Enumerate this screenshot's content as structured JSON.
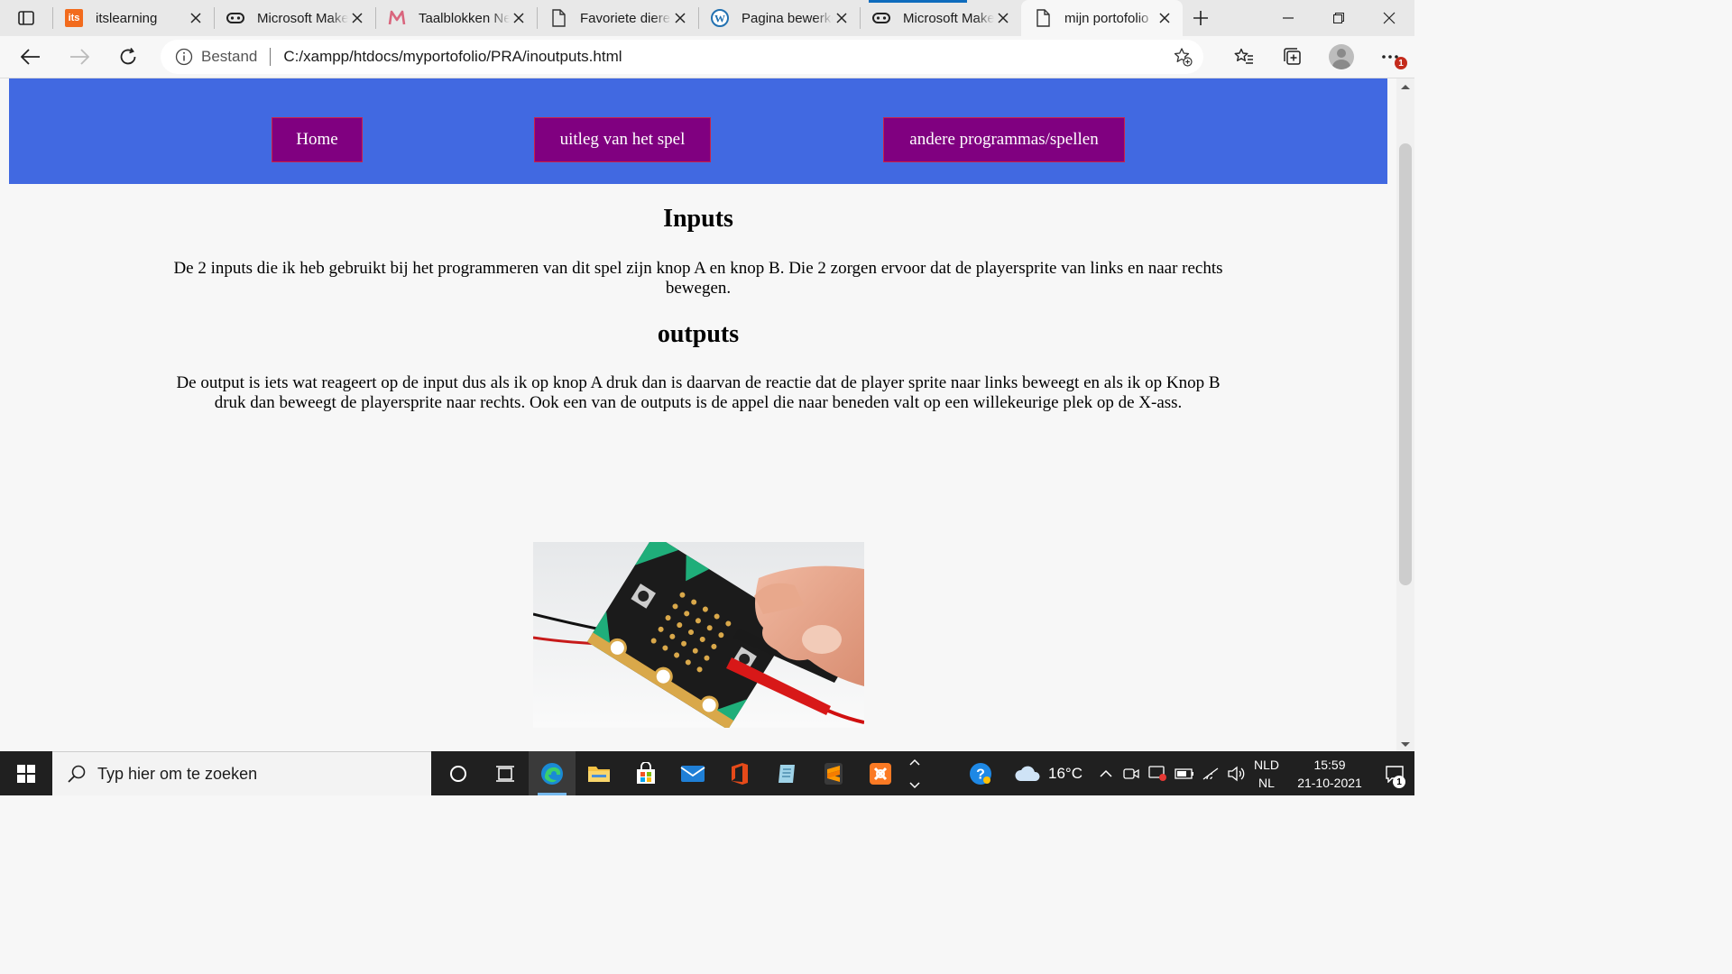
{
  "browser": {
    "tabs": [
      {
        "title": "itslearning",
        "icon": "itslearning-icon",
        "favicon_text": "its"
      },
      {
        "title": "Microsoft MakeCode",
        "icon": "makecode-icon"
      },
      {
        "title": "Taalblokken Nederlands",
        "icon": "taalblokken-icon"
      },
      {
        "title": "Favoriete dieren",
        "icon": "page-icon"
      },
      {
        "title": "Pagina bewerken",
        "icon": "wordpress-icon"
      },
      {
        "title": "Microsoft MakeCode",
        "icon": "makecode-icon"
      },
      {
        "title": "mijn portofolio",
        "icon": "page-icon",
        "active": true
      }
    ],
    "address": {
      "scheme_label": "Bestand",
      "url": "C:/xampp/htdocs/myportofolio/PRA/inoutputs.html"
    },
    "notification_badge": "1"
  },
  "page": {
    "nav": {
      "home": "Home",
      "uitleg": "uitleg van het spel",
      "andere": "andere programmas/spellen"
    },
    "inputs_heading": "Inputs",
    "inputs_text": "De 2 inputs die ik heb gebruikt bij het programmeren van dit spel zijn knop A en knop B. Die 2 zorgen ervoor dat de playersprite van links en naar rechts bewegen.",
    "outputs_heading": "outputs",
    "outputs_text": "De output is iets wat reageert op de input dus als ik op knop A druk dan is daarvan de reactie dat de player sprite naar links beweegt en als ik op Knop B druk dan beweegt de playersprite naar rechts. Ook een van de outputs is de appel die naar beneden valt op een willekeurige plek op de X-ass.",
    "image_alt": "micro:bit board"
  },
  "taskbar": {
    "search_placeholder": "Typ hier om te zoeken",
    "weather": "16°C",
    "lang_top": "NLD",
    "lang_bottom": "NL",
    "time": "15:59",
    "date": "21-10-2021",
    "notification_count": "1"
  },
  "colors": {
    "nav_bar": "#4169e1",
    "nav_button": "#800080",
    "nav_button_border": "#cc2244"
  }
}
